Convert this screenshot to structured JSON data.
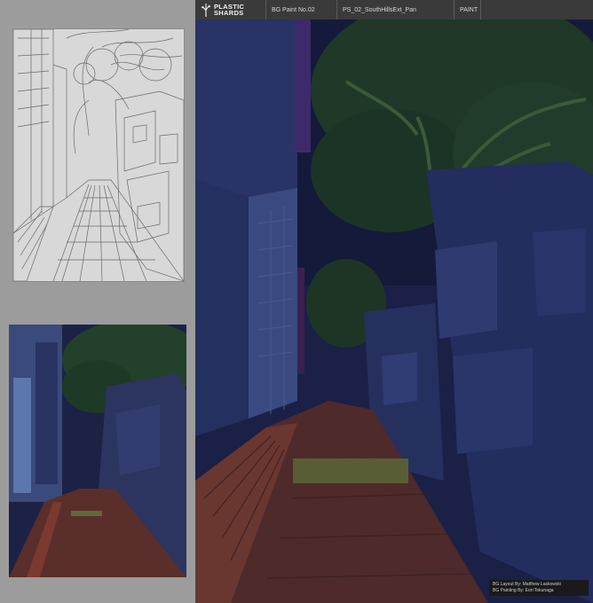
{
  "header": {
    "logo": {
      "line1": "PLASTIC",
      "line2": "SHARDS"
    },
    "paint_label": "BG Paint No.02",
    "file_name": "PS_02_SouthHillsExt_Pan",
    "stage": "PAINT"
  },
  "credits": {
    "layout": "BG Layout By: Matthew Laskowski",
    "painting": "BG Painting By: Eori Tokunaga"
  },
  "colors": {
    "header_bg": "#3a3a3a",
    "page_bg": "#9c9c9c",
    "night_blue": "#1b2248",
    "foliage": "#24432a",
    "brick": "#5a2e2a",
    "purple_sign": "#4c2f7a"
  }
}
